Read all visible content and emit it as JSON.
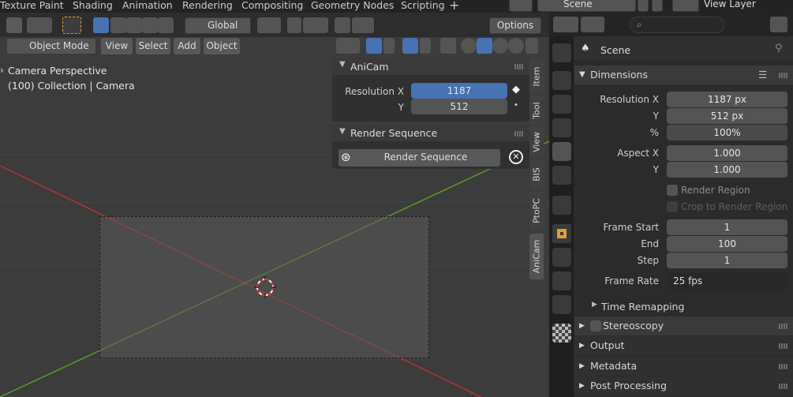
{
  "workspace_tabs": [
    "Texture Paint",
    "Shading",
    "Animation",
    "Rendering",
    "Compositing",
    "Geometry Nodes",
    "Scripting",
    "+"
  ],
  "scene_selector": "Scene",
  "view_layer": "View Layer",
  "header": {
    "transform_orientation": "Global",
    "mode": "Object Mode",
    "menus": [
      "View",
      "Select",
      "Add",
      "Object"
    ],
    "options": "Options"
  },
  "viewport": {
    "title": "Camera Perspective",
    "subtitle": "(100) Collection | Camera"
  },
  "sidebar_tabs": [
    "Item",
    "Tool",
    "View",
    "BIS",
    "PtoPC",
    "AniCam"
  ],
  "anicam": {
    "title": "AniCam",
    "res_x_label": "Resolution X",
    "res_x": "1187",
    "res_y_label": "Y",
    "res_y": "512",
    "render_seq_title": "Render Sequence",
    "render_seq_button": "Render Sequence"
  },
  "props": {
    "context": "Scene",
    "dimensions": "Dimensions",
    "res_x_label": "Resolution X",
    "res_x": "1187 px",
    "res_y_label": "Y",
    "res_y": "512 px",
    "pct_label": "%",
    "pct": "100%",
    "aspect_x_label": "Aspect X",
    "aspect_x": "1.000",
    "aspect_y_label": "Y",
    "aspect_y": "1.000",
    "render_region": "Render Region",
    "crop_region": "Crop to Render Region",
    "frame_start_label": "Frame Start",
    "frame_start": "1",
    "end_label": "End",
    "end": "100",
    "step_label": "Step",
    "step": "1",
    "frame_rate_label": "Frame Rate",
    "frame_rate": "25 fps",
    "time_remapping": "Time Remapping",
    "stereoscopy": "Stereoscopy",
    "output": "Output",
    "metadata": "Metadata",
    "post_processing": "Post Processing"
  },
  "colors": {
    "accent": "#4772b3",
    "x_axis": "#b5322f",
    "y_axis": "#5a9a2a"
  }
}
